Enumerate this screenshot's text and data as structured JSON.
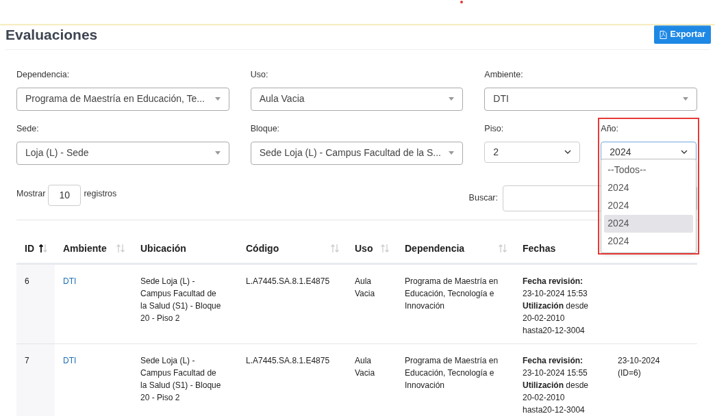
{
  "page_title": "Evaluaciones",
  "export_button": "Exportar",
  "filters": [
    {
      "label": "Dependencia:",
      "value": "Programa de Maestría en Educación, Te...",
      "kind": "search-select"
    },
    {
      "label": "Uso:",
      "value": "Aula Vacia",
      "kind": "search-select"
    },
    {
      "label": "Ambiente:",
      "value": "DTI",
      "kind": "search-select"
    },
    {
      "label": "Sede:",
      "value": "Loja (L) - Sede",
      "kind": "search-select"
    },
    {
      "label": "Bloque:",
      "value": "Sede Loja (L) - Campus Facultad de la S...",
      "kind": "search-select"
    },
    {
      "label": "Piso:",
      "value": "2",
      "kind": "native-select"
    }
  ],
  "year_filter": {
    "label": "Año:",
    "value": "2024",
    "expanded": true,
    "highlighted": true,
    "options": [
      {
        "label": "--Todos--",
        "highlighted": false
      },
      {
        "label": "2024",
        "highlighted": false
      },
      {
        "label": "2024",
        "highlighted": false
      },
      {
        "label": "2024",
        "highlighted": true
      },
      {
        "label": "2024",
        "highlighted": false
      }
    ]
  },
  "length": {
    "prefix": "Mostrar",
    "value": "10",
    "suffix": "registros"
  },
  "search": {
    "label": "Buscar:"
  },
  "table": {
    "columns": [
      {
        "label": "ID",
        "sortable": true,
        "sorted_asc": true
      },
      {
        "label": "Ambiente",
        "sortable": true
      },
      {
        "label": "Ubicación",
        "sortable": false
      },
      {
        "label": "Código",
        "sortable": true
      },
      {
        "label": "Uso",
        "sortable": true
      },
      {
        "label": "Dependencia",
        "sortable": true
      },
      {
        "label": "Fechas",
        "sortable": false
      }
    ],
    "rows": [
      {
        "id": "6",
        "ambiente": "DTI",
        "ubicacion": "Sede Loja (L) - Campus Facultad de la Salud (S1) - Bloque 20 - Piso 2",
        "codigo": "L.A7445.SA.8.1.E4875",
        "uso": "Aula Vacia",
        "dependencia": "Programa de Maestría en Educación, Tecnología e Innovación",
        "fechas": [
          "**Fecha revisión:**",
          "23-10-2024 15:53",
          "**Utilización** desde",
          "20-02-2010",
          "hasta20-12-3004"
        ],
        "column_8": []
      },
      {
        "id": "7",
        "ambiente": "DTI",
        "ubicacion": "Sede Loja (L) - Campus Facultad de la Salud (S1) - Bloque 20 - Piso 2",
        "codigo": "L.A7445.SA.8.1.E4875",
        "uso": "Aula Vacia",
        "dependencia": "Programa de Maestría en Educación, Tecnología e Innovación",
        "fechas": [
          "**Fecha revisión:**",
          "23-10-2024 15:55",
          "**Utilización** desde",
          "20-02-2010",
          "hasta20-12-3004"
        ],
        "column_8": [
          "23-10-2024",
          "(ID=6)"
        ]
      }
    ]
  }
}
